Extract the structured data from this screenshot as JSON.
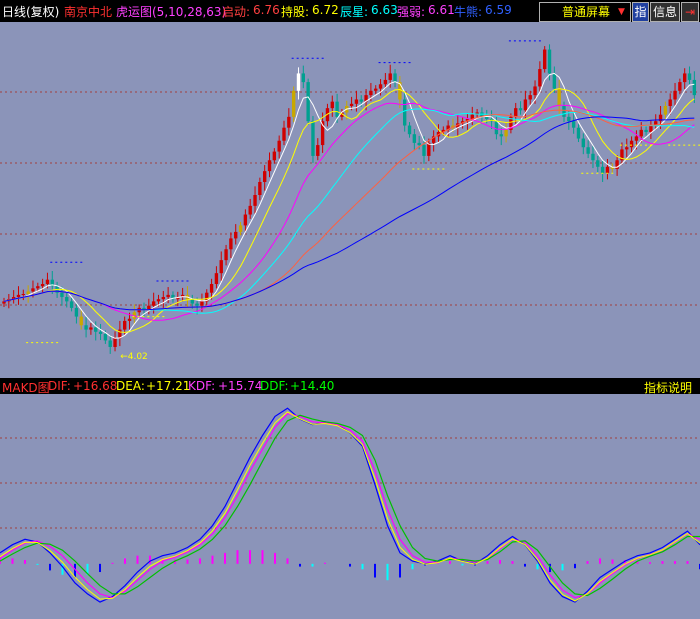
{
  "header": {
    "period": "日线(复权)",
    "stock_name": "南京中北",
    "indicator": "虎运图(5,10,28,63)",
    "qidong_label": "启动:",
    "qidong_value": "6.76",
    "chigu_label": "持股:",
    "chigu_value": "6.72",
    "chenxing_label": "辰星:",
    "chenxing_value": "6.63",
    "qiangruo_label": "强弱:",
    "qiangruo_value": "6.61",
    "niuneng_label": "牛熊:",
    "niuneng_value": "6.59",
    "screen_mode": "普通屏幕",
    "screen_arrow": "▼",
    "btn_zhi": "指",
    "btn_info": "信息",
    "btn_exit": "⇥"
  },
  "macd_header": {
    "name": "MAKD图",
    "dif_label": "DIF:",
    "dif_value": "+16.68",
    "dea_label": "DEA:",
    "dea_value": "+17.21",
    "kdf_label": "KDF:",
    "kdf_value": "+15.74",
    "ddf_label": "DDF:",
    "ddf_value": "+14.40",
    "help": "指标说明"
  },
  "colors": {
    "bg": "#8b94b9",
    "up": "#d00000",
    "down": "#00a090",
    "yellow_bar": "#c8a800",
    "white_bar": "#ffffff",
    "ma5": "#ffffff",
    "ma10": "#ffff00",
    "ma28": "#ff00ff",
    "ma63": "#00ffff",
    "ma_long": "#ff6040",
    "ma_slow": "#0000ff",
    "grid": "#a04040"
  },
  "chart_data": [
    {
      "type": "candlestick",
      "title": "南京中北 日线(复权)",
      "low_label": "4.02",
      "closes": [
        3.95,
        4.0,
        4.05,
        4.1,
        4.12,
        4.18,
        4.25,
        4.3,
        4.35,
        4.45,
        4.3,
        4.15,
        4.05,
        3.95,
        3.8,
        3.6,
        3.4,
        3.3,
        3.35,
        3.25,
        3.2,
        3.05,
        2.9,
        3.1,
        3.3,
        3.5,
        3.55,
        3.7,
        3.8,
        3.75,
        3.85,
        3.95,
        4.0,
        4.05,
        4.1,
        4.0,
        4.05,
        4.1,
        4.0,
        3.9,
        3.85,
        3.95,
        4.15,
        4.35,
        4.6,
        4.9,
        5.15,
        5.4,
        5.55,
        5.7,
        5.95,
        6.15,
        6.4,
        6.7,
        6.95,
        7.2,
        7.4,
        7.65,
        7.95,
        8.2,
        8.8,
        9.2,
        9.0,
        8.1,
        7.3,
        7.55,
        8.1,
        8.4,
        8.55,
        8.2,
        8.3,
        8.45,
        8.5,
        8.6,
        8.55,
        8.7,
        8.8,
        8.85,
        8.95,
        9.05,
        9.2,
        9.0,
        8.6,
        8.0,
        7.8,
        7.6,
        7.55,
        7.3,
        7.6,
        7.75,
        7.85,
        7.9,
        8.0,
        7.95,
        8.05,
        8.1,
        8.15,
        8.25,
        8.3,
        8.2,
        8.15,
        8.1,
        7.8,
        7.75,
        7.9,
        8.2,
        8.4,
        8.35,
        8.6,
        8.7,
        8.9,
        9.3,
        9.75,
        9.2,
        8.85,
        8.45,
        8.2,
        8.1,
        7.95,
        7.7,
        7.5,
        7.35,
        7.2,
        7.05,
        6.9,
        7.05,
        7.0,
        7.2,
        7.45,
        7.5,
        7.65,
        7.75,
        7.9,
        7.85,
        8.0,
        8.1,
        8.25,
        8.45,
        8.6,
        8.8,
        9.0,
        9.2,
        9.05,
        8.7
      ]
    },
    {
      "type": "line",
      "title": "MAKD图",
      "series": [
        {
          "name": "DIF",
          "values": [
            0.2,
            0.35,
            0.45,
            0.4,
            0.2,
            -0.05,
            -0.35,
            -0.55,
            -0.7,
            -0.6,
            -0.4,
            -0.15,
            0.05,
            0.15,
            0.2,
            0.3,
            0.45,
            0.7,
            1.05,
            1.5,
            1.95,
            2.35,
            2.7,
            2.85,
            2.65,
            2.55,
            2.6,
            2.55,
            2.4,
            2.15,
            1.45,
            0.7,
            0.2,
            0.05,
            0.0,
            0.05,
            0.15,
            0.05,
            0.0,
            0.15,
            0.35,
            0.5,
            0.35,
            0.05,
            -0.35,
            -0.6,
            -0.7,
            -0.5,
            -0.25,
            -0.1,
            0.05,
            0.15,
            0.2,
            0.3,
            0.45,
            0.6,
            0.35
          ]
        },
        {
          "name": "DEA",
          "values": [
            0.1,
            0.25,
            0.38,
            0.42,
            0.32,
            0.15,
            -0.1,
            -0.35,
            -0.55,
            -0.62,
            -0.5,
            -0.3,
            -0.1,
            0.05,
            0.12,
            0.22,
            0.35,
            0.55,
            0.85,
            1.25,
            1.7,
            2.1,
            2.5,
            2.75,
            2.7,
            2.6,
            2.58,
            2.55,
            2.45,
            2.25,
            1.7,
            1.0,
            0.45,
            0.15,
            0.03,
            0.03,
            0.1,
            0.08,
            0.03,
            0.1,
            0.28,
            0.45,
            0.4,
            0.15,
            -0.2,
            -0.48,
            -0.62,
            -0.55,
            -0.35,
            -0.18,
            -0.02,
            0.1,
            0.17,
            0.25,
            0.4,
            0.55,
            0.45
          ]
        },
        {
          "name": "KDF",
          "values": [
            0.05,
            0.18,
            0.3,
            0.38,
            0.36,
            0.25,
            0.05,
            -0.18,
            -0.4,
            -0.55,
            -0.55,
            -0.42,
            -0.25,
            -0.08,
            0.05,
            0.15,
            0.27,
            0.45,
            0.7,
            1.05,
            1.45,
            1.88,
            2.3,
            2.62,
            2.72,
            2.65,
            2.6,
            2.57,
            2.5,
            2.35,
            1.9,
            1.25,
            0.7,
            0.3,
            0.1,
            0.05,
            0.08,
            0.08,
            0.05,
            0.08,
            0.22,
            0.4,
            0.42,
            0.25,
            -0.05,
            -0.35,
            -0.55,
            -0.58,
            -0.45,
            -0.28,
            -0.1,
            0.05,
            0.14,
            0.22,
            0.35,
            0.5,
            0.5
          ]
        }
      ],
      "histogram": [
        0.1,
        0.1,
        0.07,
        -0.02,
        -0.12,
        -0.2,
        -0.25,
        -0.2,
        -0.15,
        0.02,
        0.1,
        0.15,
        0.15,
        0.1,
        0.08,
        0.08,
        0.1,
        0.15,
        0.2,
        0.25,
        0.25,
        0.25,
        0.2,
        0.1,
        -0.05,
        -0.05,
        0.02,
        0.0,
        -0.05,
        -0.1,
        -0.25,
        -0.3,
        -0.25,
        -0.1,
        -0.03,
        0.02,
        0.05,
        -0.03,
        -0.03,
        0.05,
        0.07,
        0.05,
        -0.05,
        -0.1,
        -0.15,
        -0.12,
        -0.08,
        0.05,
        0.1,
        0.08,
        0.07,
        0.05,
        0.03,
        0.05,
        0.05,
        0.05,
        -0.1
      ]
    }
  ]
}
